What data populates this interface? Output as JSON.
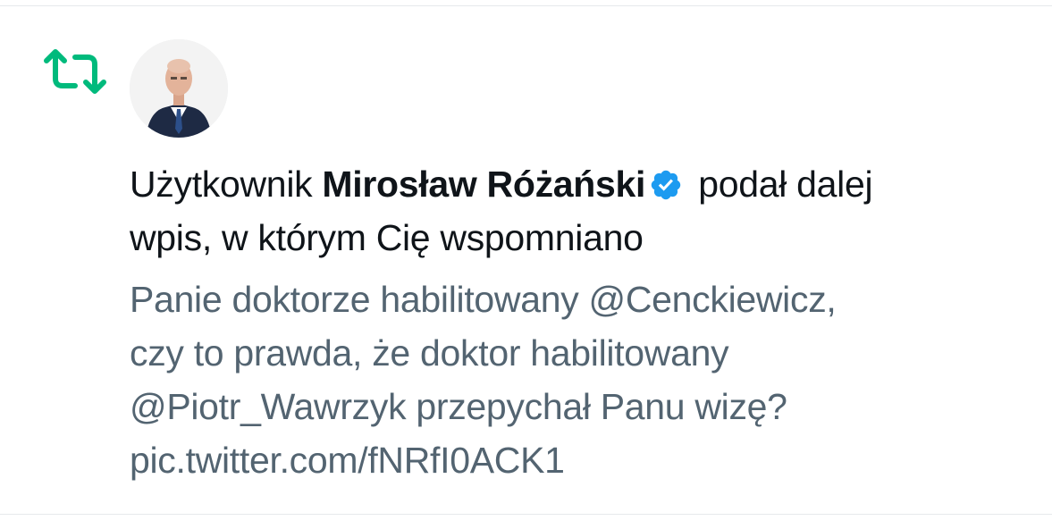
{
  "notification": {
    "prefix": "Użytkownik",
    "user_name": "Mirosław Różański",
    "action_line1": "podał dalej",
    "action_line2": "wpis, w którym Cię wspomniano"
  },
  "tweet": {
    "lines": [
      "Panie doktorze habilitowany @Cenckiewicz,",
      "czy to prawda, że doktor habilitowany",
      "@Piotr_Wawrzyk przepychał Panu wizę?",
      "pic.twitter.com/fNRfI0ACK1"
    ]
  },
  "icons": {
    "retweet": "retweet-icon",
    "verified": "verified-badge-icon"
  },
  "colors": {
    "retweet_green": "#00ba7c",
    "verified_blue": "#1d9bf0",
    "text_primary": "#0f1419",
    "text_secondary": "#536471"
  }
}
